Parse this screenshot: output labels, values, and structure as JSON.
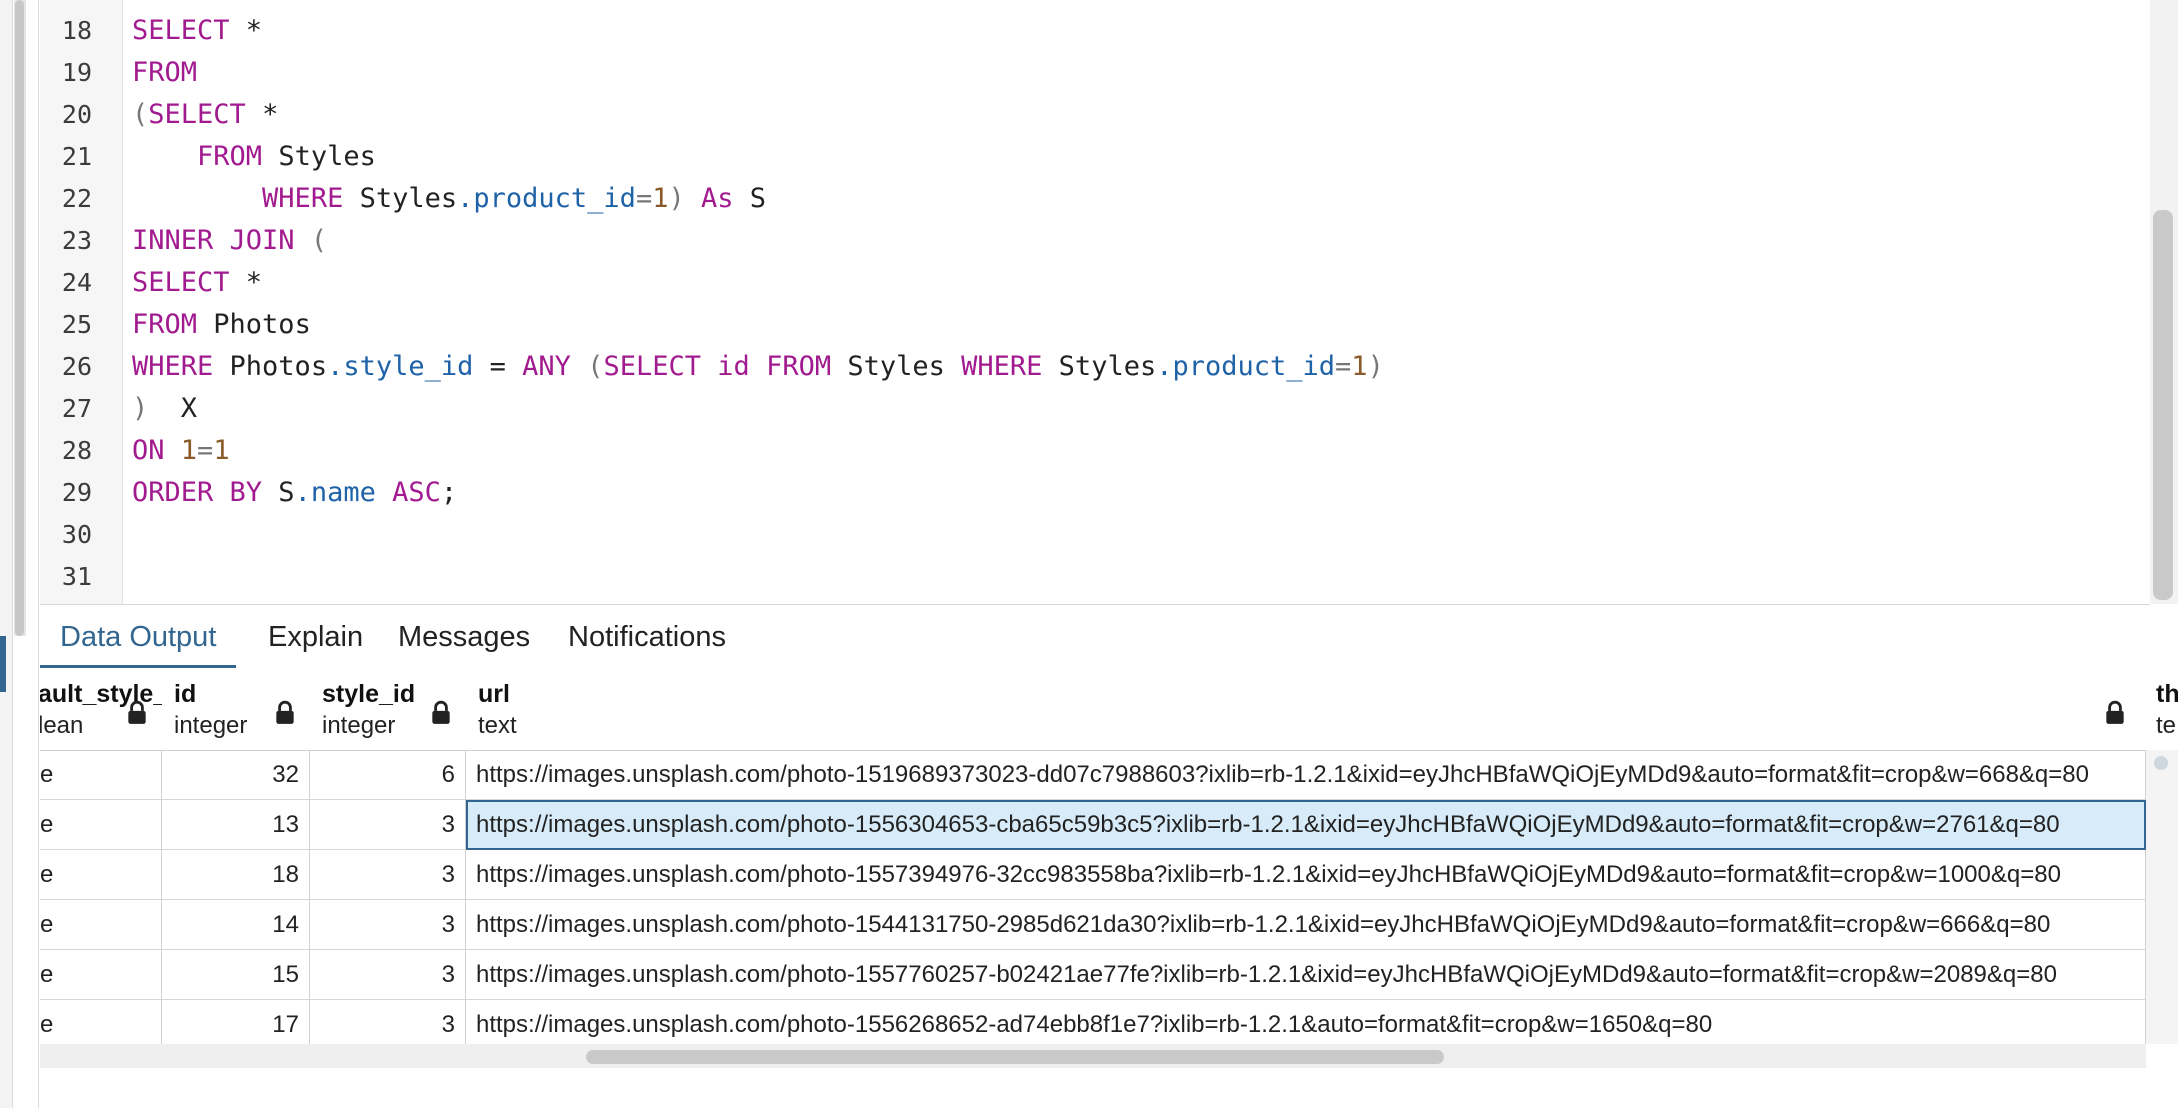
{
  "editor": {
    "lines": [
      {
        "num": "18",
        "tokens": [
          {
            "t": "SELECT",
            "c": "kw"
          },
          {
            "t": " *",
            "c": ""
          }
        ]
      },
      {
        "num": "19",
        "tokens": [
          {
            "t": "FROM",
            "c": "kw"
          }
        ]
      },
      {
        "num": "20",
        "tokens": [
          {
            "t": "(",
            "c": "punc"
          },
          {
            "t": "SELECT",
            "c": "kw"
          },
          {
            "t": " *",
            "c": ""
          }
        ]
      },
      {
        "num": "21",
        "tokens": [
          {
            "t": "    ",
            "c": ""
          },
          {
            "t": "FROM",
            "c": "kw"
          },
          {
            "t": " Styles",
            "c": ""
          }
        ]
      },
      {
        "num": "22",
        "tokens": [
          {
            "t": "        ",
            "c": ""
          },
          {
            "t": "WHERE",
            "c": "kw"
          },
          {
            "t": " Styles",
            "c": ""
          },
          {
            "t": ".product_id",
            "c": "fld"
          },
          {
            "t": "=",
            "c": "punc"
          },
          {
            "t": "1",
            "c": "num"
          },
          {
            "t": ")",
            "c": "punc"
          },
          {
            "t": " ",
            "c": ""
          },
          {
            "t": "As",
            "c": "kw"
          },
          {
            "t": " S",
            "c": ""
          }
        ]
      },
      {
        "num": "23",
        "tokens": [
          {
            "t": "INNER JOIN",
            "c": "kw"
          },
          {
            "t": " (",
            "c": "punc"
          }
        ]
      },
      {
        "num": "24",
        "tokens": [
          {
            "t": "SELECT",
            "c": "kw"
          },
          {
            "t": " *",
            "c": ""
          }
        ]
      },
      {
        "num": "25",
        "tokens": [
          {
            "t": "FROM",
            "c": "kw"
          },
          {
            "t": " Photos",
            "c": ""
          }
        ]
      },
      {
        "num": "26",
        "tokens": [
          {
            "t": "WHERE",
            "c": "kw"
          },
          {
            "t": " Photos",
            "c": ""
          },
          {
            "t": ".style_id",
            "c": "fld"
          },
          {
            "t": " = ",
            "c": ""
          },
          {
            "t": "ANY",
            "c": "kw"
          },
          {
            "t": " (",
            "c": "punc"
          },
          {
            "t": "SELECT",
            "c": "kw"
          },
          {
            "t": " ",
            "c": ""
          },
          {
            "t": "id",
            "c": "kw"
          },
          {
            "t": " ",
            "c": ""
          },
          {
            "t": "FROM",
            "c": "kw"
          },
          {
            "t": " Styles ",
            "c": ""
          },
          {
            "t": "WHERE",
            "c": "kw"
          },
          {
            "t": " Styles",
            "c": ""
          },
          {
            "t": ".product_id",
            "c": "fld"
          },
          {
            "t": "=",
            "c": "punc"
          },
          {
            "t": "1",
            "c": "num"
          },
          {
            "t": ")",
            "c": "punc"
          }
        ]
      },
      {
        "num": "27",
        "tokens": [
          {
            "t": ")",
            "c": "punc"
          },
          {
            "t": "  X",
            "c": ""
          }
        ]
      },
      {
        "num": "28",
        "tokens": [
          {
            "t": "ON",
            "c": "kw"
          },
          {
            "t": " ",
            "c": ""
          },
          {
            "t": "1",
            "c": "num"
          },
          {
            "t": "=",
            "c": "punc"
          },
          {
            "t": "1",
            "c": "num"
          }
        ]
      },
      {
        "num": "29",
        "tokens": [
          {
            "t": "ORDER BY",
            "c": "kw"
          },
          {
            "t": " S",
            "c": ""
          },
          {
            "t": ".name",
            "c": "fld"
          },
          {
            "t": " ",
            "c": ""
          },
          {
            "t": "ASC",
            "c": "kw"
          },
          {
            "t": ";",
            "c": ""
          }
        ]
      },
      {
        "num": "30",
        "tokens": []
      },
      {
        "num": "31",
        "tokens": []
      }
    ]
  },
  "tabs": [
    "Data Output",
    "Explain",
    "Messages",
    "Notifications"
  ],
  "grid": {
    "columns": [
      {
        "name": "ault_style_",
        "type": "lean"
      },
      {
        "name": "id",
        "type": "integer"
      },
      {
        "name": "style_id",
        "type": "integer"
      },
      {
        "name": "url",
        "type": "text"
      },
      {
        "name": "th",
        "type": "te"
      }
    ],
    "rows": [
      {
        "c0": "e",
        "id": "32",
        "style_id": "6",
        "url": "https://images.unsplash.com/photo-1519689373023-dd07c7988603?ixlib=rb-1.2.1&ixid=eyJhcHBfaWQiOjEyMDd9&auto=format&fit=crop&w=668&q=80"
      },
      {
        "c0": "e",
        "id": "13",
        "style_id": "3",
        "url": "https://images.unsplash.com/photo-1556304653-cba65c59b3c5?ixlib=rb-1.2.1&ixid=eyJhcHBfaWQiOjEyMDd9&auto=format&fit=crop&w=2761&q=80"
      },
      {
        "c0": "e",
        "id": "18",
        "style_id": "3",
        "url": "https://images.unsplash.com/photo-1557394976-32cc983558ba?ixlib=rb-1.2.1&ixid=eyJhcHBfaWQiOjEyMDd9&auto=format&fit=crop&w=1000&q=80"
      },
      {
        "c0": "e",
        "id": "14",
        "style_id": "3",
        "url": "https://images.unsplash.com/photo-1544131750-2985d621da30?ixlib=rb-1.2.1&ixid=eyJhcHBfaWQiOjEyMDd9&auto=format&fit=crop&w=666&q=80"
      },
      {
        "c0": "e",
        "id": "15",
        "style_id": "3",
        "url": "https://images.unsplash.com/photo-1557760257-b02421ae77fe?ixlib=rb-1.2.1&ixid=eyJhcHBfaWQiOjEyMDd9&auto=format&fit=crop&w=2089&q=80"
      },
      {
        "c0": "e",
        "id": "17",
        "style_id": "3",
        "url": "https://images.unsplash.com/photo-1556268652-ad74ebb8f1e7?ixlib=rb-1.2.1&auto=format&fit=crop&w=1650&q=80"
      }
    ],
    "selected_row": 1
  },
  "colors": {
    "accent": "#326690",
    "keyword": "#a21a8f",
    "field": "#1e62a8",
    "number": "#8a5a2b",
    "selection": "#d8ebf8"
  },
  "icons": {
    "column_lock": "lock-icon"
  }
}
